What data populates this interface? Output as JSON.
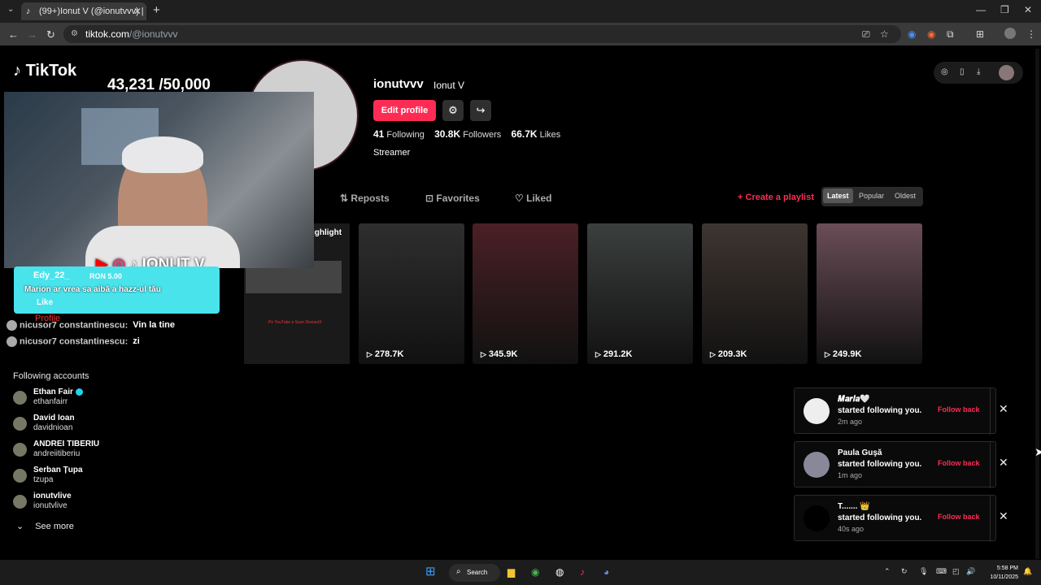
{
  "browser": {
    "tab_title": "(99+)Ionut V (@ionutvvv) | TikT",
    "url_host": "tiktok.com",
    "url_path": "/@ionutvvv"
  },
  "tiktok": {
    "logo": "TikTok",
    "username": "ionutvvv",
    "display_name": "Ionut V",
    "edit_profile": "Edit profile",
    "stats": {
      "following": "41",
      "following_label": "Following",
      "followers": "30.8K",
      "followers_label": "Followers",
      "likes": "66.7K",
      "likes_label": "Likes"
    },
    "bio": "Streamer",
    "tabs": {
      "reposts": "Reposts",
      "favorites": "Favorites",
      "liked": "Liked"
    },
    "create_playlist": "Create a playlist",
    "sort": [
      "Latest",
      "Popular",
      "Oldest"
    ],
    "highlight": "ighlight",
    "highlight_caption": "Pe YouTube e Sezo DeviantX",
    "videos": [
      {
        "views": "278.7K",
        "color": "#2e2e2e"
      },
      {
        "views": "345.9K",
        "color": "#4a2025"
      },
      {
        "views": "291.2K",
        "color": "#3b3f3d"
      },
      {
        "views": "209.3K",
        "color": "#3e3530"
      },
      {
        "views": "249.9K",
        "color": "#6a4d58"
      }
    ],
    "following_title": "Following accounts",
    "accounts": [
      {
        "name": "Ethan Fair",
        "user": "ethanfairr",
        "verified": true
      },
      {
        "name": "David Ioan",
        "user": "davidnioan",
        "verified": false
      },
      {
        "name": "ANDREI TIBERIU",
        "user": "andreiitiberiu",
        "verified": false
      },
      {
        "name": "Serban Țupa",
        "user": "tzupa",
        "verified": false
      },
      {
        "name": "ionutvlive",
        "user": "ionutvlive",
        "verified": false
      }
    ],
    "see_more": "See more"
  },
  "overlay": {
    "goal": "43,231 /50,000",
    "banner_name": "IONUT V",
    "chat_user": "Edy_22_",
    "chat_amount": "RON 5.00",
    "chat_message": "Marion ar vrea sa aibă a hazz-ul tău",
    "chat_like": "Like",
    "profile": "Profile",
    "chat_lines": [
      {
        "user": "nicusor7 constantinescu:",
        "msg": "Vin la tine"
      },
      {
        "user": "nicusor7 constantinescu:",
        "msg": "zi"
      }
    ]
  },
  "notifications": [
    {
      "name": "𝑴𝒂𝒓𝒊𝒂🤍",
      "text": "started following you.",
      "time": "2m ago",
      "action": "Follow back"
    },
    {
      "name": "Paula Guşă",
      "text": "started following you.",
      "time": "1m ago",
      "action": "Follow back"
    },
    {
      "name": "T....... 👑",
      "text": "started following you.",
      "time": "40s ago",
      "action": "Follow back"
    }
  ],
  "taskbar": {
    "search": "Search",
    "time": "5:58 PM",
    "date": "10/11/2025"
  },
  "colors": {
    "accent": "#fe2c55",
    "chat_bg": "#49e3ec"
  }
}
